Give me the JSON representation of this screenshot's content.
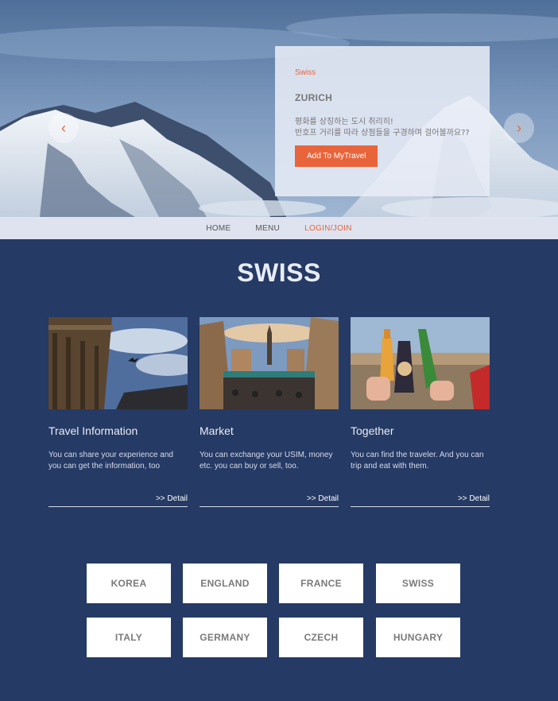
{
  "hero": {
    "prev_arrow": "‹",
    "next_arrow": "›",
    "card": {
      "tag": "Swiss",
      "city": "ZURICH",
      "description_line1": "평화를 상징하는 도시 취리히!",
      "description_line2": "반호프 거리를 따라 상점들을 구경하며 걸어볼까요??",
      "button_label": "Add To MyTravel"
    }
  },
  "nav": {
    "home": "HOME",
    "menu": "MENU",
    "login": "LOGIN/JOIN"
  },
  "section": {
    "title": "SWISS",
    "columns": [
      {
        "heading": "Travel Information",
        "text": "You can share your experience and you can get the information, too",
        "detail": ">> Detail"
      },
      {
        "heading": "Market",
        "text": "You can exchange your USIM, money etc. you can buy or sell, too.",
        "detail": ">> Detail"
      },
      {
        "heading": "Together",
        "text": "You can find the traveler. And you can trip and eat with them.",
        "detail": ">> Detail"
      }
    ]
  },
  "countries": [
    "KOREA",
    "ENGLAND",
    "FRANCE",
    "SWISS",
    "ITALY",
    "GERMANY",
    "CZECH",
    "HUNGARY"
  ],
  "colors": {
    "accent": "#e8643a",
    "background": "#253a64",
    "nav_bg": "#dfe3ef"
  }
}
